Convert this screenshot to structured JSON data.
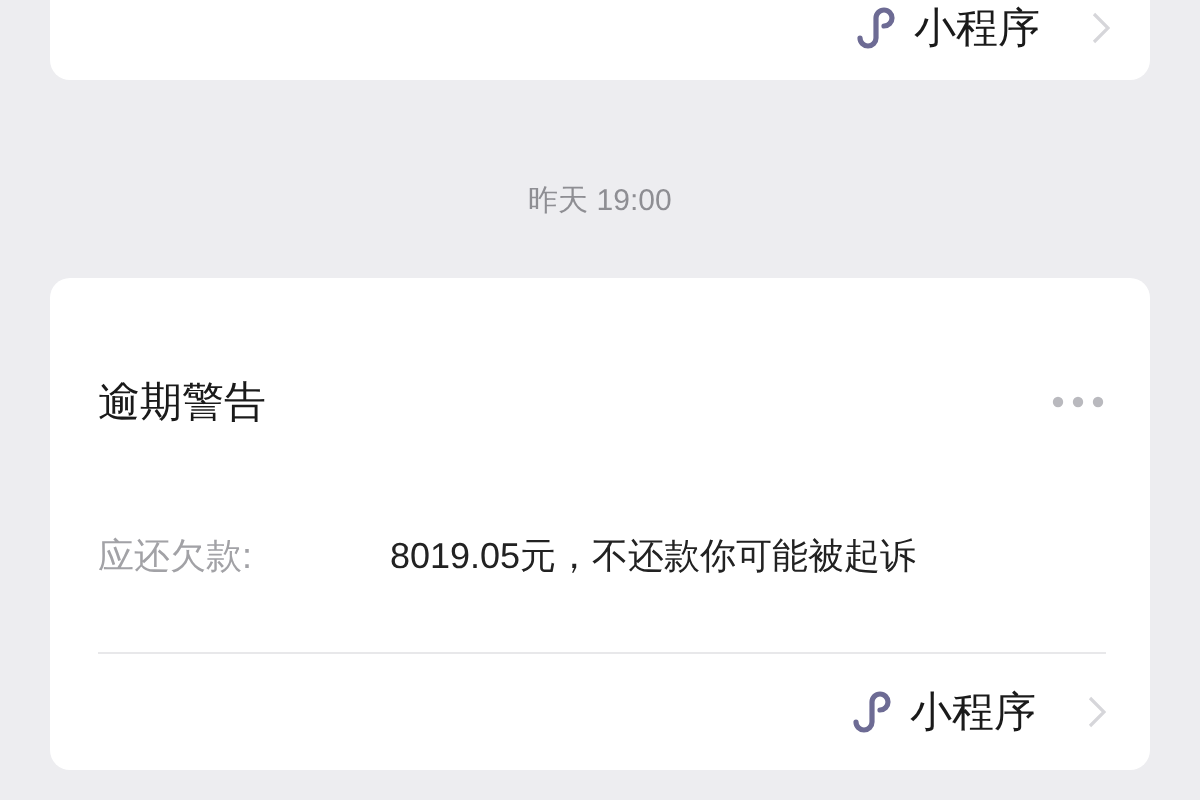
{
  "previous_card": {
    "footer_link": "小程序"
  },
  "timestamp": "昨天 19:00",
  "card": {
    "title": "逾期警告",
    "fields": [
      {
        "label": "应还欠款:",
        "value": "8019.05元，不还款你可能被起诉"
      }
    ],
    "footer_link": "小程序"
  }
}
